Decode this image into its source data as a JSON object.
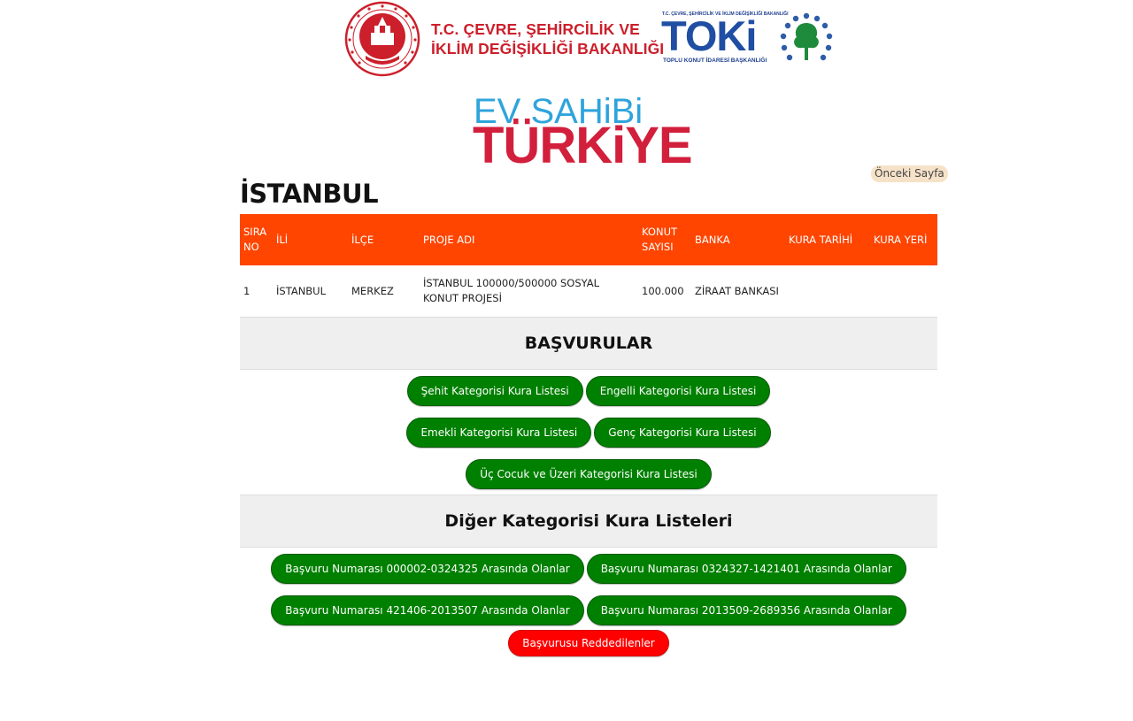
{
  "header": {
    "ministry_name_line1": "T.C. ÇEVRE, ŞEHİRCİLİK VE",
    "ministry_name_line2": "İKLİM DEĞİŞİKLİĞİ BAKANLIĞI",
    "toki_small_top": "T.C. ÇEVRE, ŞEHİRCİLİK VE İKLİM DEĞİŞİKLİĞİ BAKANLIĞI",
    "toki_wordmark": "TOKi",
    "toki_small_bottom": "TOPLU KONUT İDARESİ BAŞKANLIĞI",
    "campaign_line1": "EV SAHiBi",
    "campaign_line2": "TÜRKiYE",
    "colors": {
      "ministry_red": "#cc1f2b",
      "toki_blue": "#1f4ea3",
      "campaign_blue": "#2fa4dc",
      "campaign_red": "#d21f3c"
    }
  },
  "nav": {
    "back_label": "Önceki Sayfa"
  },
  "city_title": "İSTANBUL",
  "table": {
    "columns": [
      "SIRA NO",
      "İLİ",
      "İLÇE",
      "PROJE ADI",
      "KONUT SAYISI",
      "BANKA",
      "KURA TARİHİ",
      "KURA YERİ"
    ],
    "rows": [
      [
        "1",
        "İSTANBUL",
        "MERKEZ",
        "İSTANBUL  100000/500000 SOSYAL KONUT PROJESİ",
        "100.000",
        "ZİRAAT BANKASI",
        "",
        ""
      ]
    ],
    "header_color": "#ff4500"
  },
  "applications": {
    "title": "BAŞVURULAR",
    "buttons": [
      "Şehit Kategorisi Kura Listesi",
      "Engelli Kategorisi Kura Listesi",
      "Emekli Kategorisi Kura Listesi",
      "Genç Kategorisi Kura Listesi",
      "Üç Cocuk ve Üzeri Kategorisi Kura Listesi"
    ]
  },
  "other": {
    "title": "Diğer Kategorisi Kura Listeleri",
    "buttons": [
      "Başvuru Numarası 000002-0324325 Arasında Olanlar",
      "Başvuru Numarası 0324327-1421401 Arasında Olanlar",
      "Başvuru Numarası 421406-2013507 Arasında Olanlar",
      "Başvuru Numarası 2013509-2689356 Arasında Olanlar"
    ],
    "rejected_label": "Başvurusu Reddedilenler"
  },
  "button_colors": {
    "green": "#008000",
    "red": "#ff0000"
  }
}
